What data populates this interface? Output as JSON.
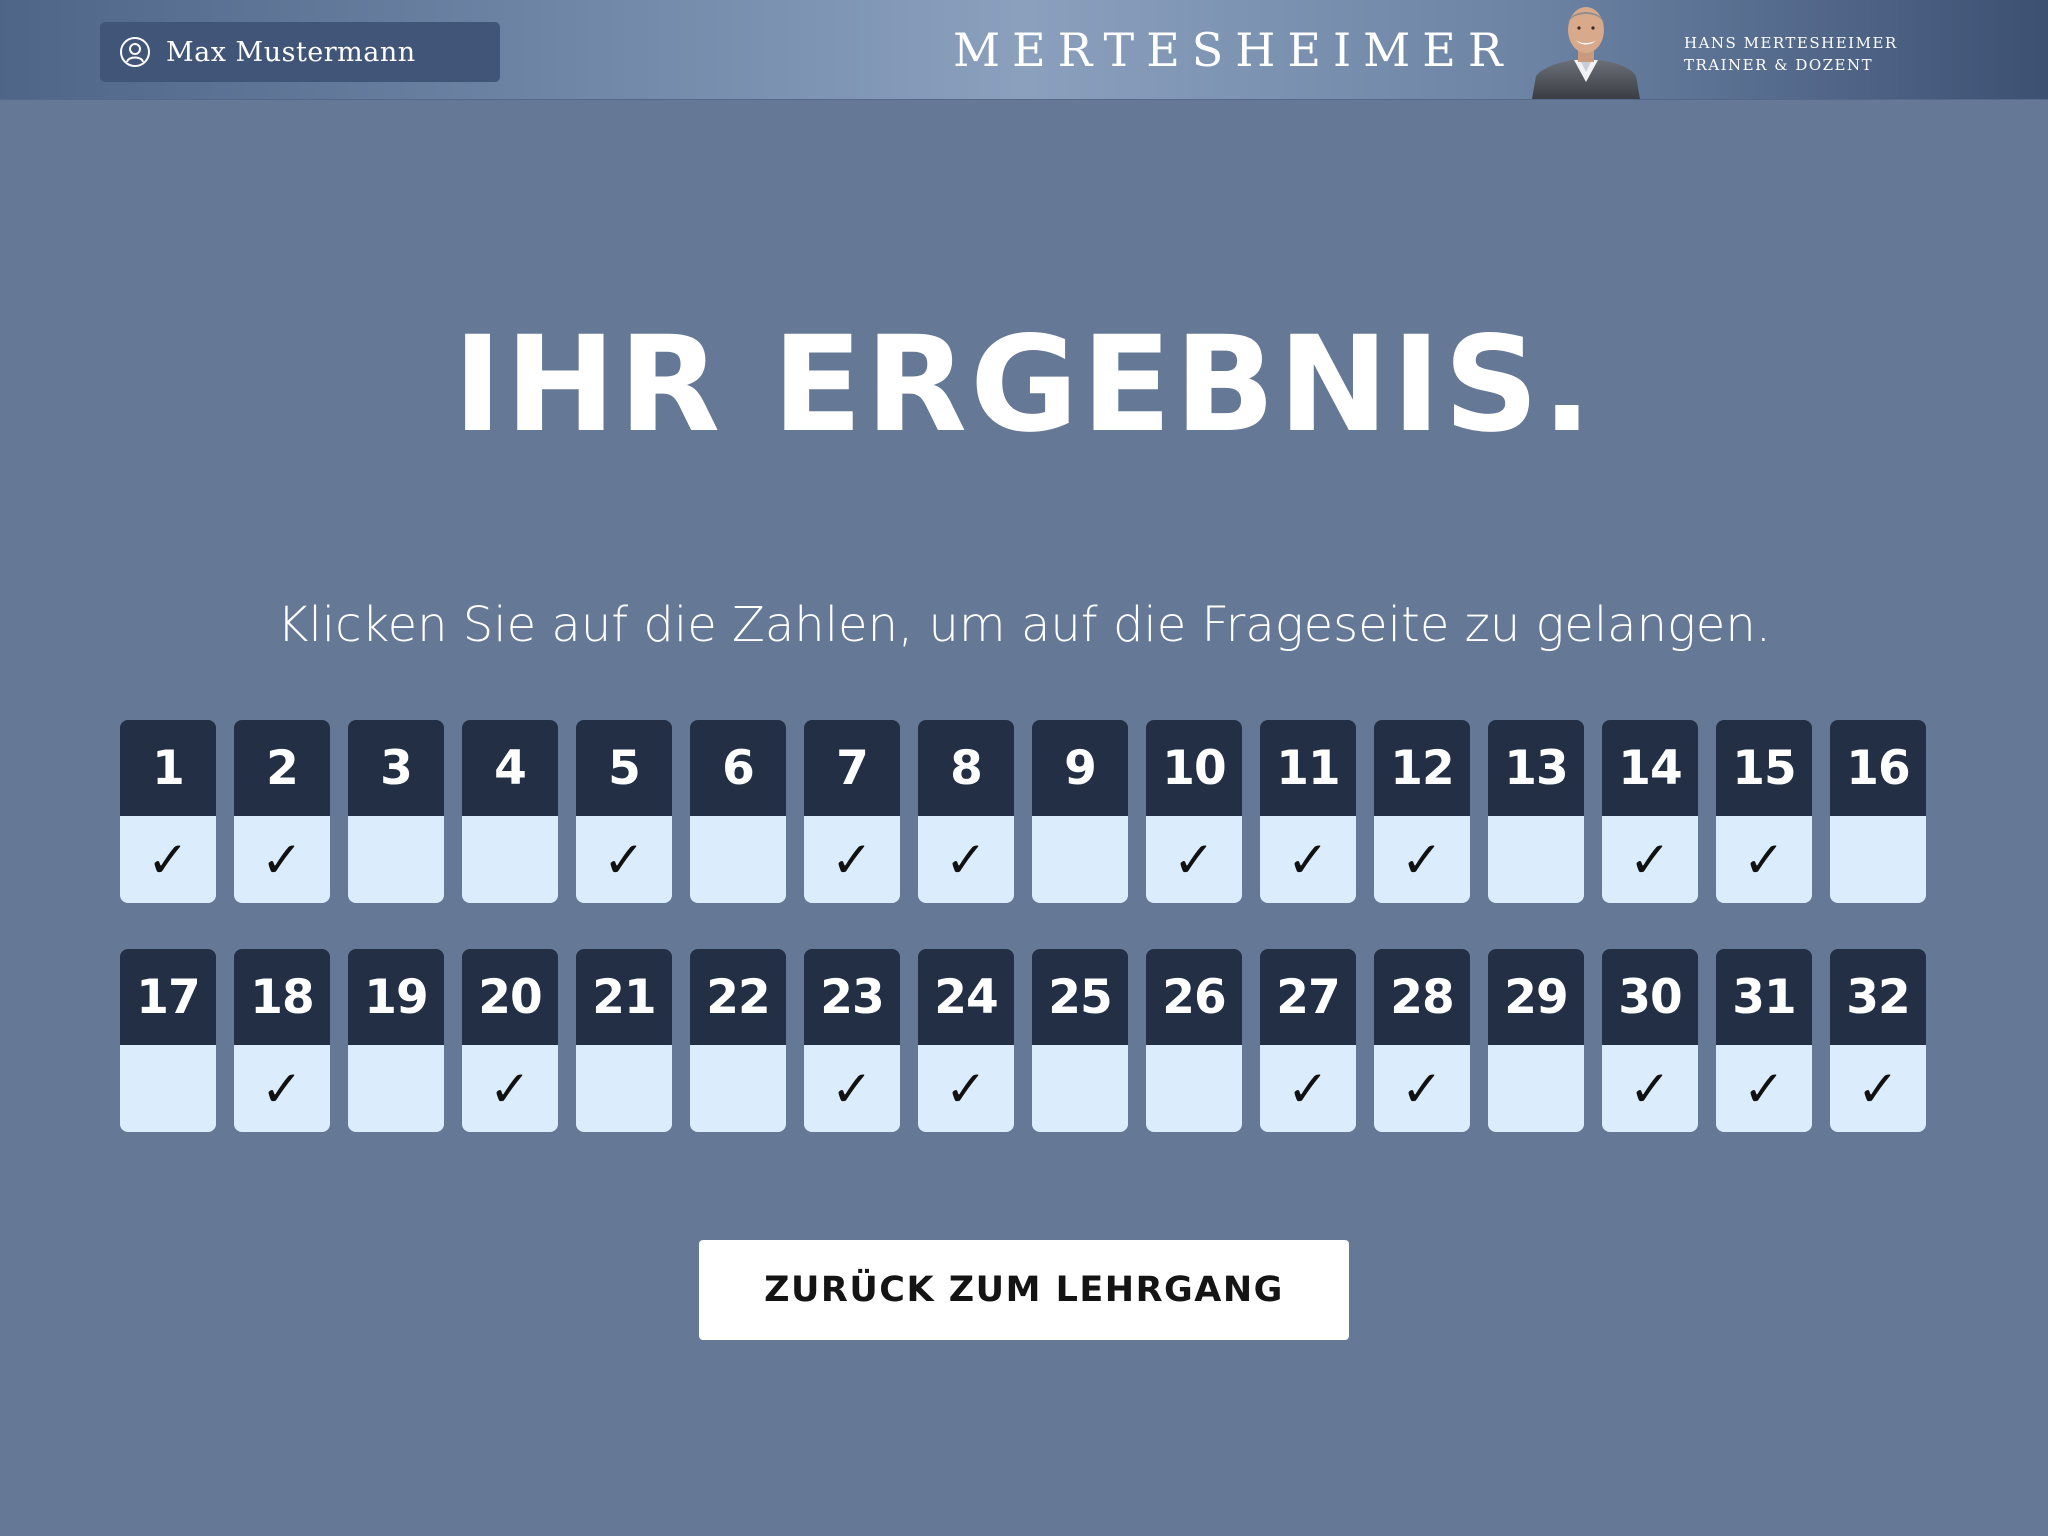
{
  "header": {
    "user_name": "Max Mustermann",
    "brand": "MERTESHEIMER",
    "trainer_name": "HANS MERTESHEIMER",
    "trainer_role": "TRAINER & DOZENT"
  },
  "main": {
    "title": "IHR ERGEBNIS.",
    "instruction": "Klicken Sie auf die Zahlen, um auf die Frageseite zu gelangen.",
    "check_symbol": "✓",
    "questions": [
      {
        "number": "1",
        "answered": true
      },
      {
        "number": "2",
        "answered": true
      },
      {
        "number": "3",
        "answered": false
      },
      {
        "number": "4",
        "answered": false
      },
      {
        "number": "5",
        "answered": true
      },
      {
        "number": "6",
        "answered": false
      },
      {
        "number": "7",
        "answered": true
      },
      {
        "number": "8",
        "answered": true
      },
      {
        "number": "9",
        "answered": false
      },
      {
        "number": "10",
        "answered": true
      },
      {
        "number": "11",
        "answered": true
      },
      {
        "number": "12",
        "answered": true
      },
      {
        "number": "13",
        "answered": false
      },
      {
        "number": "14",
        "answered": true
      },
      {
        "number": "15",
        "answered": true
      },
      {
        "number": "16",
        "answered": false
      },
      {
        "number": "17",
        "answered": false
      },
      {
        "number": "18",
        "answered": true
      },
      {
        "number": "19",
        "answered": false
      },
      {
        "number": "20",
        "answered": true
      },
      {
        "number": "21",
        "answered": false
      },
      {
        "number": "22",
        "answered": false
      },
      {
        "number": "23",
        "answered": true
      },
      {
        "number": "24",
        "answered": true
      },
      {
        "number": "25",
        "answered": false
      },
      {
        "number": "26",
        "answered": false
      },
      {
        "number": "27",
        "answered": true
      },
      {
        "number": "28",
        "answered": true
      },
      {
        "number": "29",
        "answered": false
      },
      {
        "number": "30",
        "answered": true
      },
      {
        "number": "31",
        "answered": true
      },
      {
        "number": "32",
        "answered": true
      }
    ],
    "back_button_label": "ZURÜCK ZUM LEHRGANG"
  },
  "icons": {
    "user": "user-icon",
    "portrait": "trainer-portrait"
  },
  "colors": {
    "background": "#657895",
    "card_header": "#232f44",
    "card_body": "#dbecfd",
    "button": "#ffffff"
  }
}
